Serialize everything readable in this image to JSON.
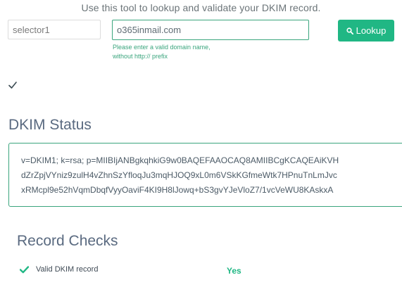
{
  "intro": "Use this tool to lookup and validate your DKIM record.",
  "form": {
    "selector_value": "selector1",
    "domain_value": "o365inmail.com",
    "hint_line1": "Please enter a valid domain name,",
    "hint_line2": "without http:// prefix",
    "lookup_label": "Lookup"
  },
  "status": {
    "title": "DKIM Status",
    "record_lines": [
      "v=DKIM1; k=rsa; p=MIIBIjANBgkqhkiG9w0BAQEFAAOCAQ8AMIIBCgKCAQEAiKVH",
      "dZrZpjVYniz9zulH4vZhnSzYfloqJu3mqHJOQ9xL0m6VSkKGfmeWtk7HPnuTnLmJvc",
      "xRMcpl9e52hVqmDbqfVyyOaviF4KI9H8lJowq+bS3gvYJeVloZ7/1vcVeWU8KAskxA"
    ]
  },
  "checks": {
    "title": "Record Checks",
    "items": [
      {
        "label": "Valid DKIM record",
        "value": "Yes"
      }
    ]
  },
  "colors": {
    "accent": "#20b784",
    "border_green": "#3aa57d",
    "heading": "#5a6a80"
  }
}
